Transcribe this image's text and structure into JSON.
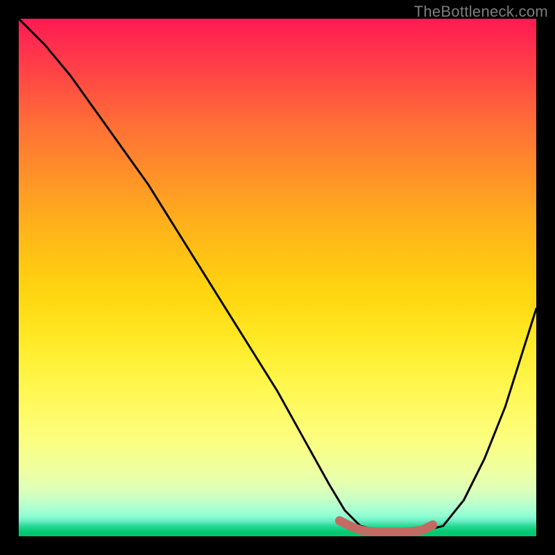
{
  "watermark": "TheBottleneck.com",
  "chart_data": {
    "type": "line",
    "title": "",
    "xlabel": "",
    "ylabel": "",
    "xlim": [
      0,
      100
    ],
    "ylim": [
      0,
      100
    ],
    "series": [
      {
        "name": "curve",
        "color": "#000000",
        "x": [
          0,
          5,
          10,
          15,
          20,
          25,
          30,
          35,
          40,
          45,
          50,
          55,
          60,
          63,
          66,
          70,
          74,
          78,
          82,
          86,
          90,
          94,
          100
        ],
        "y": [
          100,
          95,
          89,
          82,
          75,
          68,
          60,
          52,
          44,
          36,
          28,
          19,
          10,
          5,
          2,
          1,
          1,
          1,
          2,
          7,
          15,
          25,
          44
        ]
      },
      {
        "name": "bottom-highlight",
        "color": "#c26b63",
        "x": [
          62,
          64,
          66,
          68,
          70,
          72,
          74,
          76,
          78,
          80
        ],
        "y": [
          3,
          2,
          1.2,
          0.9,
          0.8,
          0.8,
          0.8,
          0.9,
          1.2,
          2.2
        ]
      }
    ],
    "background_gradient": {
      "type": "vertical",
      "stops": [
        {
          "pos": 0.0,
          "color": "#ff1a52"
        },
        {
          "pos": 0.25,
          "color": "#ff7f30"
        },
        {
          "pos": 0.5,
          "color": "#ffce11"
        },
        {
          "pos": 0.75,
          "color": "#fffa62"
        },
        {
          "pos": 0.95,
          "color": "#91ffd3"
        },
        {
          "pos": 1.0,
          "color": "#00c870"
        }
      ]
    }
  }
}
